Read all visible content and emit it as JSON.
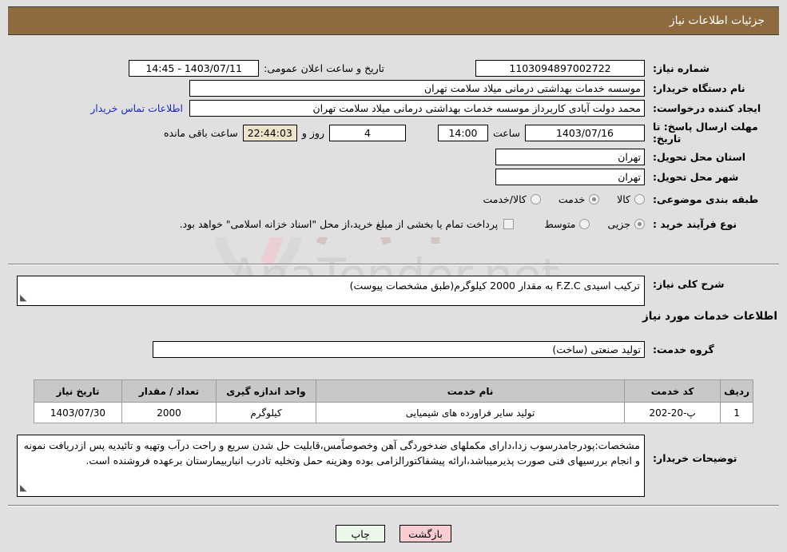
{
  "header": {
    "title": "جزئیات اطلاعات نیاز",
    "bar_color": "#8d6b3f"
  },
  "form": {
    "need_number_label": "شماره نیاز:",
    "need_number_value": "1103094897002722",
    "announce_label": "تاریخ و ساعت اعلان عمومی:",
    "announce_value": "1403/07/11 - 14:45",
    "buyer_org_label": "نام دستگاه خریدار:",
    "buyer_org_value": "موسسه خدمات بهداشتی درمانی میلاد سلامت تهران",
    "creator_label": "ایجاد کننده درخواست:",
    "creator_value": "محمد دولت آبادی کاربرداز موسسه خدمات بهداشتی درمانی میلاد سلامت تهران",
    "contact_link": "اطلاعات تماس خریدار",
    "deadline_label": "مهلت ارسال پاسخ: تا تاریخ:",
    "deadline_date": "1403/07/16",
    "deadline_hour_label": "ساعت",
    "deadline_hour": "14:00",
    "remaining_days": "4",
    "remaining_days_label": "روز و",
    "remaining_time": "22:44:03",
    "remaining_time_label": "ساعت باقی مانده",
    "province_label": "استان محل تحویل:",
    "province_value": "تهران",
    "city_label": "شهر محل تحویل:",
    "city_value": "تهران",
    "classification_label": "طبقه بندی موضوعی:",
    "classification_options": [
      {
        "label": "کالا",
        "selected": false
      },
      {
        "label": "خدمت",
        "selected": true
      },
      {
        "label": "کالا/خدمت",
        "selected": false
      }
    ],
    "process_type_label": "نوع فرآیند خرید :",
    "process_type_options": [
      {
        "label": "جزیی",
        "selected": true
      },
      {
        "label": "متوسط",
        "selected": false
      }
    ],
    "treasury_checkbox_label": "پرداخت تمام یا بخشی از مبلغ خرید،از محل \"اسناد خزانه اسلامی\" خواهد بود.",
    "treasury_checked": false,
    "general_desc_label": "شرح کلی نیاز:",
    "general_desc_value": "ترکیب اسیدی F.Z.C به مقدار 2000 کیلوگرم(طبق مشخصات پیوست)",
    "services_section_title": "اطلاعات خدمات مورد نیاز",
    "service_group_label": "گروه خدمت:",
    "service_group_value": "تولید صنعتی (ساخت)",
    "buyer_notes_label": "توضیحات خریدار:",
    "buyer_notes_value": "مشخصات:پودرجامدرسوب زدا،دارای مکملهای ضدخوردگی آهن وخصوصاًمس،قابلیت حل شدن سریع و راحت درآب وتهیه و تائیدیه پس ازدریافت نمونه و انجام بررسیهای فنی صورت پذیرمیباشد،ارائه پیشفاکتورالزامی بوده وهزینه حمل وتخلیه تادرب انباربیمارستان برعهده فروشنده است."
  },
  "table": {
    "headers": [
      "ردیف",
      "کد خدمت",
      "نام خدمت",
      "واحد اندازه گیری",
      "تعداد / مقدار",
      "تاریخ نیاز"
    ],
    "rows": [
      {
        "index": "1",
        "code": "پ-20-202",
        "name": "تولید سایر فراورده های شیمیایی",
        "unit": "کیلوگرم",
        "quantity": "2000",
        "date": "1403/07/30"
      }
    ]
  },
  "buttons": {
    "print": "چاپ",
    "back": "بازگشت"
  },
  "watermark": {
    "text": "AnaTender.net"
  }
}
